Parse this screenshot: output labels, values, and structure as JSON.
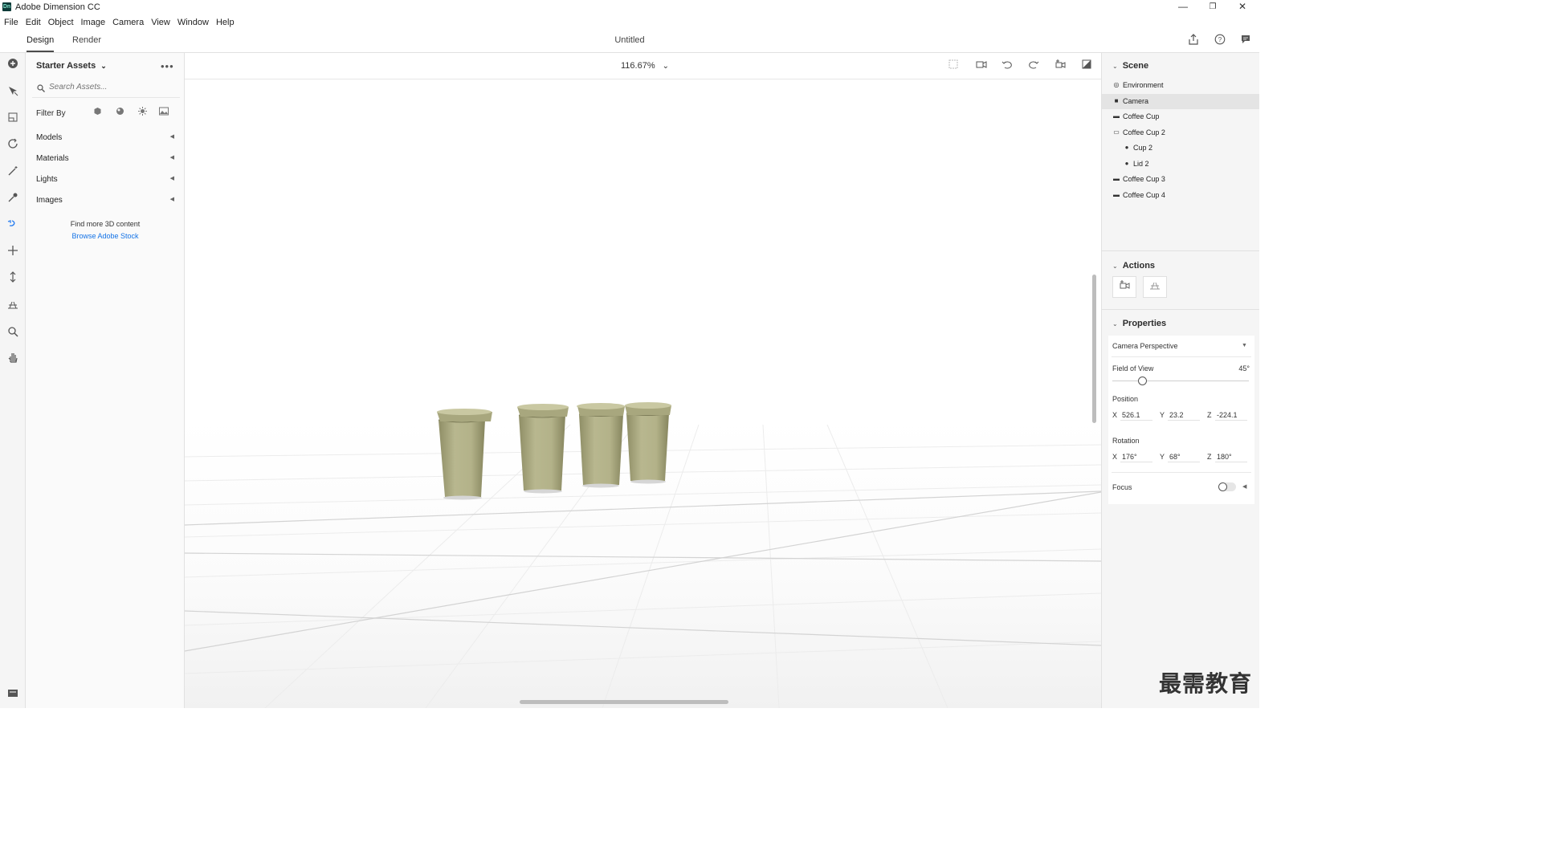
{
  "window": {
    "app_icon": "Dn",
    "title": "Adobe Dimension CC",
    "minimize": "—",
    "restore": "❐",
    "close": "✕"
  },
  "menu": [
    "File",
    "Edit",
    "Object",
    "Image",
    "Camera",
    "View",
    "Window",
    "Help"
  ],
  "tabs": {
    "design": "Design",
    "render": "Render"
  },
  "document_title": "Untitled",
  "assets": {
    "header": "Starter Assets",
    "search_placeholder": "Search Assets...",
    "filter_label": "Filter By",
    "categories": [
      "Models",
      "Materials",
      "Lights",
      "Images"
    ],
    "more_content": "Find more 3D content",
    "stock_link": "Browse Adobe Stock"
  },
  "viewport": {
    "zoom": "116.67%",
    "model_color": "#b5b48c"
  },
  "scene": {
    "title": "Scene",
    "items": [
      "Environment",
      "Camera",
      "Coffee Cup",
      "Coffee Cup 2",
      "Cup 2",
      "Lid 2",
      "Coffee Cup 3",
      "Coffee Cup 4"
    ],
    "selected": "Camera"
  },
  "actions": {
    "title": "Actions"
  },
  "properties": {
    "title": "Properties",
    "mode": "Camera Perspective",
    "fov_label": "Field of View",
    "fov_value": "45°",
    "fov_fraction": 0.22,
    "position_label": "Position",
    "position": {
      "x": "526.1",
      "y": "23.2",
      "z": "-224.1"
    },
    "rotation_label": "Rotation",
    "rotation": {
      "x": "176°",
      "y": "68°",
      "z": "180°"
    },
    "axes": {
      "x": "X",
      "y": "Y",
      "z": "Z"
    },
    "focus_label": "Focus",
    "focus_on": false
  },
  "watermark": "最需教育",
  "colors": {
    "accent_link": "#1473e6",
    "selected_row": "#e4e4e4"
  }
}
